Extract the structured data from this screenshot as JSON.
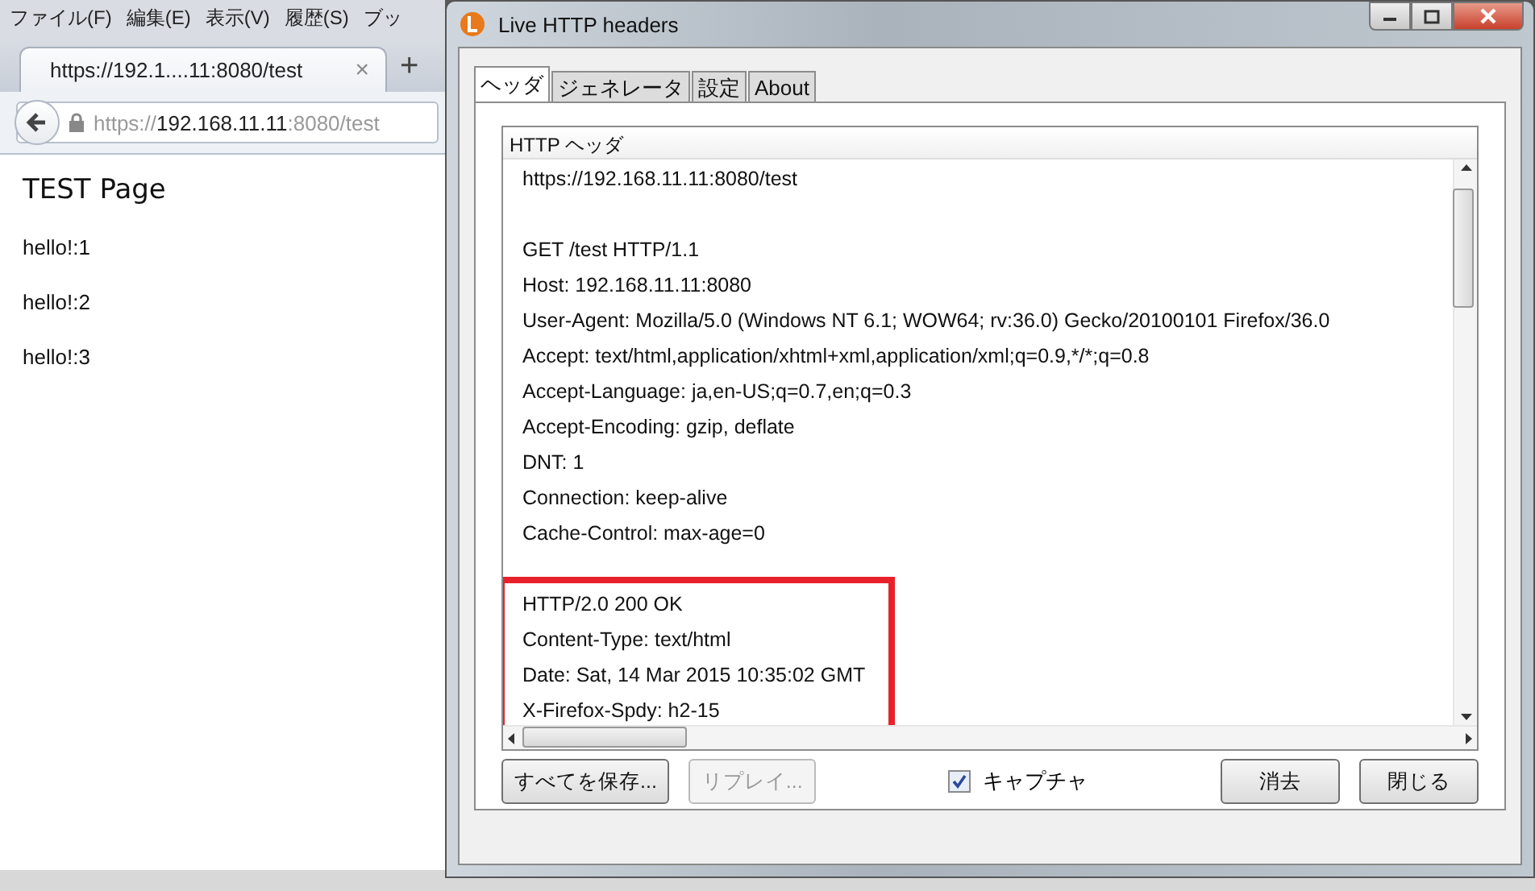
{
  "browser": {
    "menu": [
      "ファイル(F)",
      "編集(E)",
      "表示(V)",
      "履歴(S)",
      "ブッ"
    ],
    "tab": {
      "title": "https://192.1....11:8080/test",
      "close": "×"
    },
    "new_tab": "+",
    "url": {
      "scheme": "https://",
      "host": "192.168.11.11",
      "rest": ":8080/test"
    },
    "page": {
      "heading": "TEST Page",
      "lines": [
        "hello!:1",
        "hello!:2",
        "hello!:3"
      ]
    }
  },
  "dialog": {
    "title": "Live HTTP headers",
    "tabs": [
      {
        "label": "ヘッダ",
        "selected": true
      },
      {
        "label": "ジェネレータ",
        "selected": false
      },
      {
        "label": "設定",
        "selected": false
      },
      {
        "label": "About",
        "selected": false
      }
    ],
    "list_header": "HTTP ヘッダ",
    "blocks": [
      {
        "highlighted": false,
        "lines": [
          "https://192.168.11.11:8080/test"
        ]
      },
      {
        "highlighted": false,
        "lines": [
          "GET /test HTTP/1.1",
          "Host: 192.168.11.11:8080",
          "User-Agent: Mozilla/5.0 (Windows NT 6.1; WOW64; rv:36.0) Gecko/20100101 Firefox/36.0",
          "Accept: text/html,application/xhtml+xml,application/xml;q=0.9,*/*;q=0.8",
          "Accept-Language: ja,en-US;q=0.7,en;q=0.3",
          "Accept-Encoding: gzip, deflate",
          "DNT: 1",
          "Connection: keep-alive",
          "Cache-Control: max-age=0"
        ]
      },
      {
        "highlighted": true,
        "lines": [
          "HTTP/2.0 200 OK",
          "Content-Type: text/html",
          "Date: Sat, 14 Mar 2015 10:35:02 GMT",
          "X-Firefox-Spdy: h2-15"
        ]
      }
    ],
    "buttons": [
      {
        "label": "すべてを保存...",
        "disabled": false
      },
      {
        "label": "リプレイ...",
        "disabled": true
      }
    ],
    "capture": {
      "label": "キャプチャ",
      "checked": true
    },
    "right_buttons": [
      "消去",
      "閉じる"
    ]
  }
}
